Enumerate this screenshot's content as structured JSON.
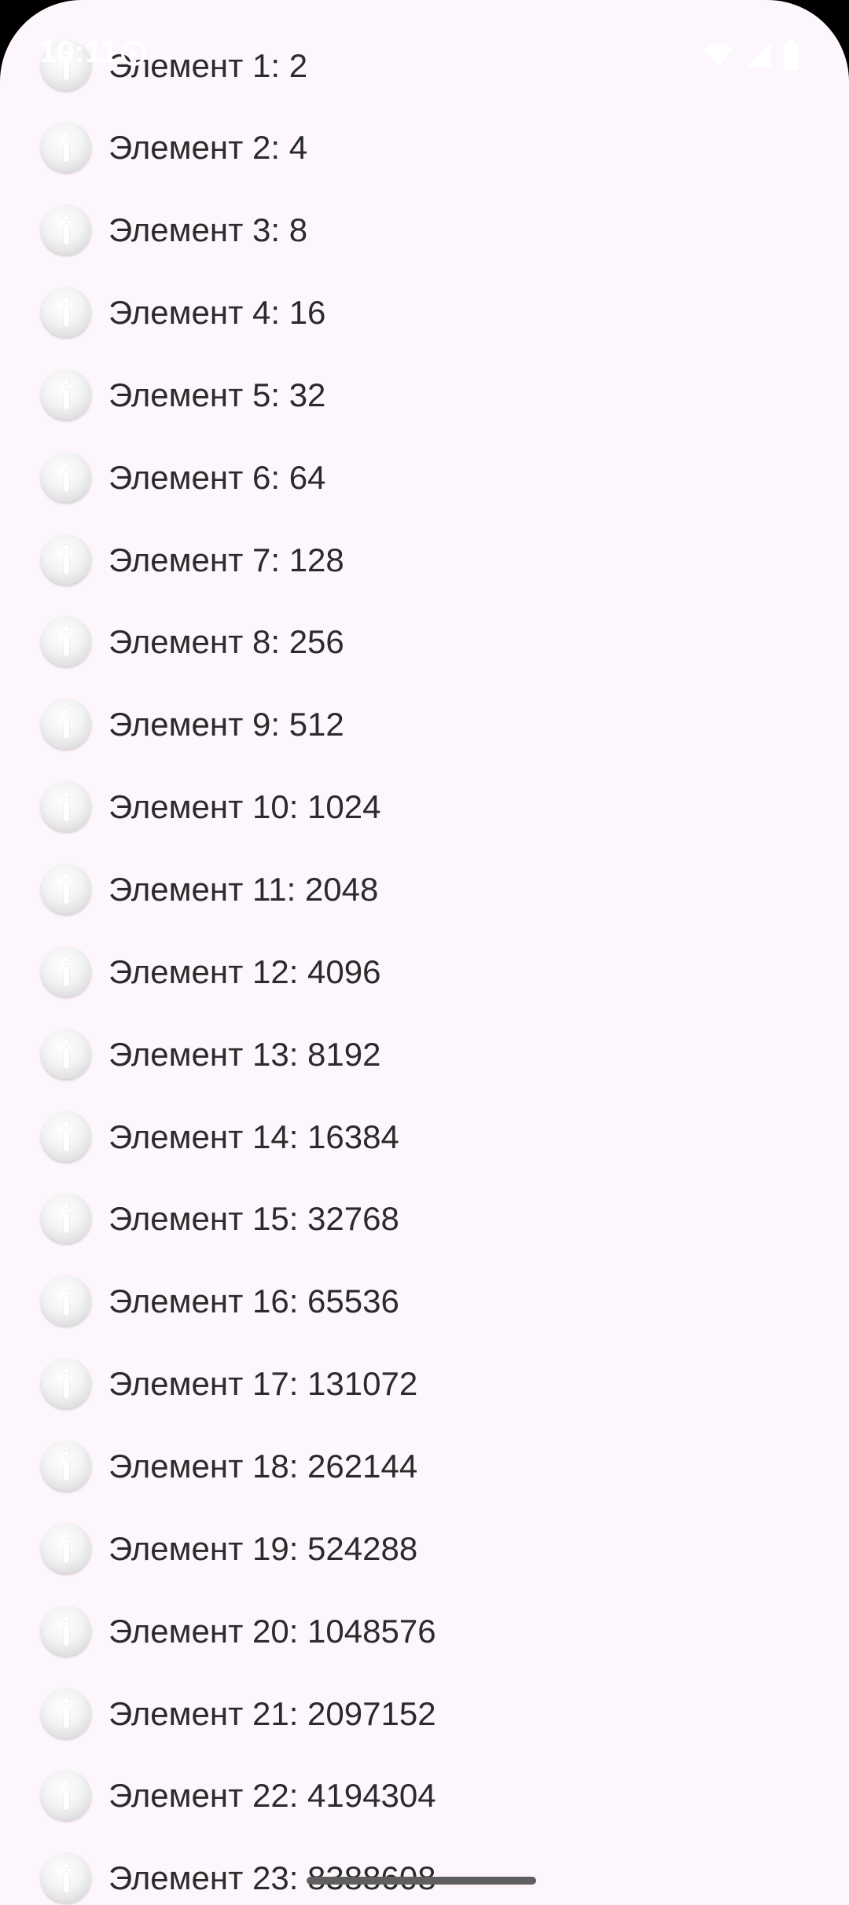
{
  "status_bar": {
    "time": "10:11",
    "icons": [
      "notification-icon",
      "wifi-icon",
      "signal-icon",
      "battery-icon"
    ]
  },
  "list": {
    "item_icon": "info-icon",
    "items": [
      {
        "label": "Элемент 1: 2"
      },
      {
        "label": "Элемент 2: 4"
      },
      {
        "label": "Элемент 3: 8"
      },
      {
        "label": "Элемент 4: 16"
      },
      {
        "label": "Элемент 5: 32"
      },
      {
        "label": "Элемент 6: 64"
      },
      {
        "label": "Элемент 7: 128"
      },
      {
        "label": "Элемент 8: 256"
      },
      {
        "label": "Элемент 9: 512"
      },
      {
        "label": "Элемент 10: 1024"
      },
      {
        "label": "Элемент 11: 2048"
      },
      {
        "label": "Элемент 12: 4096"
      },
      {
        "label": "Элемент 13: 8192"
      },
      {
        "label": "Элемент 14: 16384"
      },
      {
        "label": "Элемент 15: 32768"
      },
      {
        "label": "Элемент 16: 65536"
      },
      {
        "label": "Элемент 17: 131072"
      },
      {
        "label": "Элемент 18: 262144"
      },
      {
        "label": "Элемент 19: 524288"
      },
      {
        "label": "Элемент 20: 1048576"
      },
      {
        "label": "Элемент 21: 2097152"
      },
      {
        "label": "Элемент 22: 4194304"
      },
      {
        "label": "Элемент 23: 8388608"
      }
    ]
  },
  "colors": {
    "background": "#fdf7fd",
    "text": "#2b2b2b",
    "nav_handle": "#5f5f5f"
  }
}
